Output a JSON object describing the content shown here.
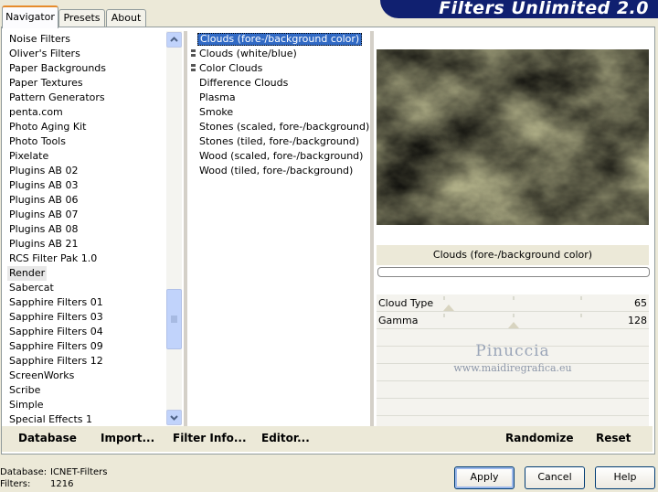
{
  "tabs": [
    {
      "label": "Navigator"
    },
    {
      "label": "Presets"
    },
    {
      "label": "About"
    }
  ],
  "banner_title": "Filters Unlimited 2.0",
  "categories": [
    "Noise Filters",
    "Oliver's Filters",
    "Paper Backgrounds",
    "Paper Textures",
    "Pattern Generators",
    "penta.com",
    "Photo Aging Kit",
    "Photo Tools",
    "Pixelate",
    "Plugins AB 02",
    "Plugins AB 03",
    "Plugins AB 06",
    "Plugins AB 07",
    "Plugins AB 08",
    "Plugins AB 21",
    "RCS Filter Pak 1.0",
    "Render",
    "Sabercat",
    "Sapphire Filters 01",
    "Sapphire Filters 03",
    "Sapphire Filters 04",
    "Sapphire Filters 09",
    "Sapphire Filters 12",
    "ScreenWorks",
    "Scribe",
    "Simple",
    "Special Effects 1"
  ],
  "selected_category": "Render",
  "filters": [
    "Clouds (fore-/background color)",
    "Clouds (white/blue)",
    "Color Clouds",
    "Difference Clouds",
    "Plasma",
    "Smoke",
    "Stones (scaled, fore-/background)",
    "Stones (tiled, fore-/background)",
    "Wood (scaled, fore-/background)",
    "Wood (tiled, fore-/background)"
  ],
  "selected_filter": "Clouds (fore-/background color)",
  "preview_filter_name": "Clouds (fore-/background color)",
  "params": [
    {
      "label": "Cloud Type",
      "value": "65"
    },
    {
      "label": "Gamma",
      "value": "128"
    }
  ],
  "watermark": {
    "line1": "Pinuccia",
    "line2": "www.maidiregrafica.eu"
  },
  "bottom_buttons": {
    "database": "Database",
    "import": "Import...",
    "filter_info": "Filter Info...",
    "editor": "Editor...",
    "randomize": "Randomize",
    "reset": "Reset"
  },
  "status": {
    "database_label": "Database:",
    "database_value": "ICNET-Filters",
    "filters_label": "Filters:",
    "filters_value": "1216"
  },
  "dialog_buttons": {
    "apply": "Apply",
    "cancel": "Cancel",
    "help": "Help"
  },
  "colors": {
    "selection": "#316ac5",
    "banner": "#102070",
    "cloud_dark": "#2e5a5e",
    "cloud_light": "#c8c79a"
  }
}
